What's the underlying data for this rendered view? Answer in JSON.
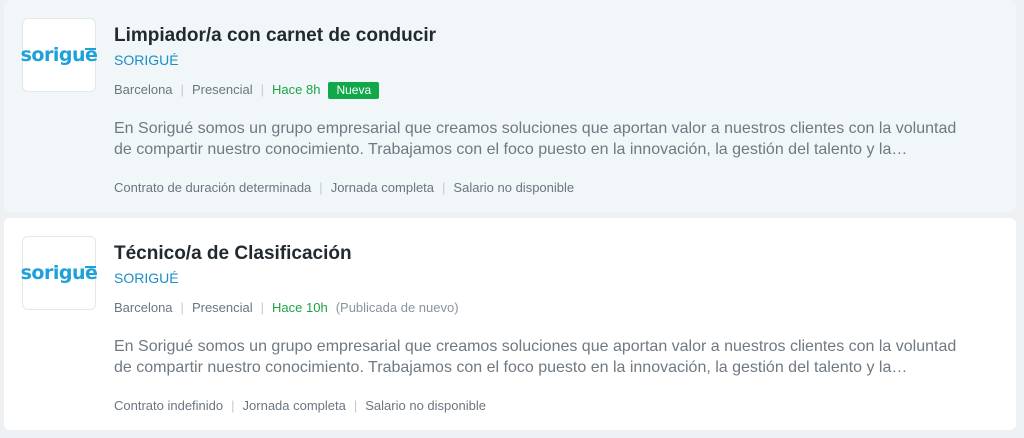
{
  "brand": {
    "logo_text": "sorigue",
    "logo_color": "#1ea0d8"
  },
  "colors": {
    "company_link": "#1a8fc7",
    "time_green": "#1ea345",
    "badge_bg": "#10a84a",
    "highlight_bg": "#f1f6f9"
  },
  "offers": [
    {
      "title": "Limpiador/a con carnet de conducir",
      "company": "SORIGUÉ",
      "location": "Barcelona",
      "modality": "Presencial",
      "posted": "Hace 8h",
      "badge": "Nueva",
      "description": "En Sorigué somos un grupo empresarial que creamos soluciones que aportan valor a nuestros clientes con la voluntad de compartir nuestro conocimiento. Trabajamos con el foco puesto en la innovación, la gestión del talento y la sostenibilidad.",
      "contract": "Contrato de duración determinada",
      "workday": "Jornada completa",
      "salary": "Salario no disponible"
    },
    {
      "title": "Técnico/a de Clasificación",
      "company": "SORIGUÉ",
      "location": "Barcelona",
      "modality": "Presencial",
      "posted": "Hace 10h",
      "republished": "(Publicada de nuevo)",
      "description": "En Sorigué somos un grupo empresarial que creamos soluciones que aportan valor a nuestros clientes con la voluntad de compartir nuestro conocimiento. Trabajamos con el foco puesto en la innovación, la gestión del talento y la sostenibilidad.",
      "contract": "Contrato indefinido",
      "workday": "Jornada completa",
      "salary": "Salario no disponible"
    }
  ]
}
